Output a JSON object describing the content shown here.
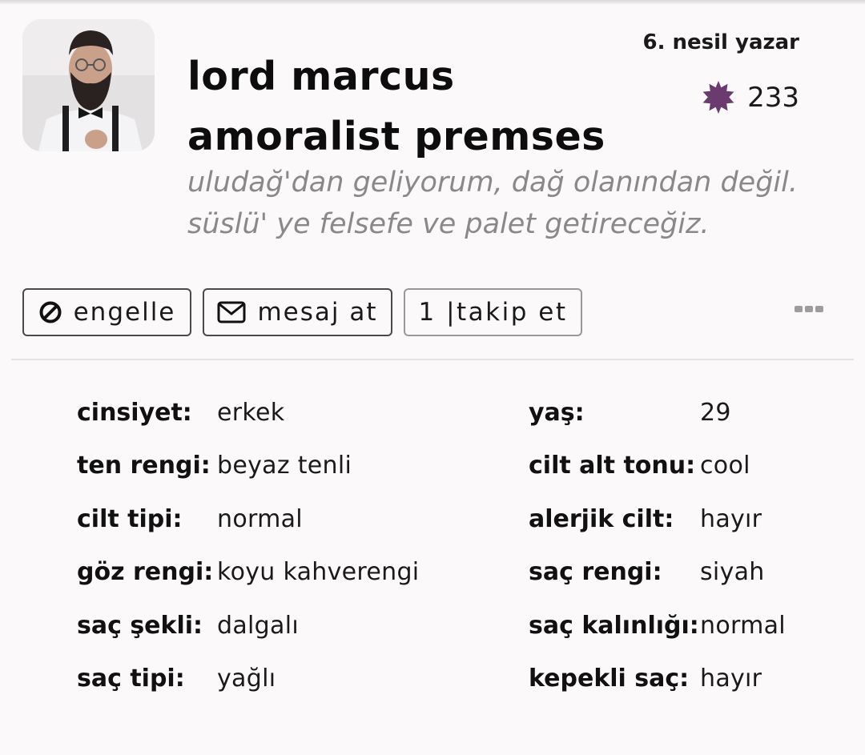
{
  "profile": {
    "name_line1": "lord marcus",
    "name_line2": "amoralist premses",
    "bio_line1": "uludağ'dan geliyorum, dağ olanından değil.",
    "bio_line2": "süslü' ye felsefe ve palet getireceğiz.",
    "generation": "6. nesil yazar",
    "badge_icon": "purple-star-badge-icon",
    "badge_color": "#6b3a6e",
    "badge_count": "233",
    "avatar": "bearded-man-avatar"
  },
  "actions": {
    "block_label": "engelle",
    "block_icon": "block-icon",
    "message_label": "mesaj at",
    "message_icon": "envelope-icon",
    "follow_label": "1 |takip et",
    "more_icon": "more-dots-icon"
  },
  "attributes": {
    "left": [
      {
        "label": "cinsiyet:",
        "value": "erkek"
      },
      {
        "label": "ten rengi:",
        "value": "beyaz tenli"
      },
      {
        "label": "cilt tipi:",
        "value": "normal"
      },
      {
        "label": "göz rengi:",
        "value": "koyu kahverengi"
      },
      {
        "label": "saç şekli:",
        "value": "dalgalı"
      },
      {
        "label": "saç tipi:",
        "value": "yağlı"
      }
    ],
    "right": [
      {
        "label": "yaş:",
        "value": "29"
      },
      {
        "label": "cilt alt tonu:",
        "value": "cool"
      },
      {
        "label": "alerjik cilt:",
        "value": "hayır"
      },
      {
        "label": "saç rengi:",
        "value": "siyah"
      },
      {
        "label": "saç kalınlığı:",
        "value": "normal"
      },
      {
        "label": "kepekli saç:",
        "value": "hayır"
      }
    ]
  }
}
